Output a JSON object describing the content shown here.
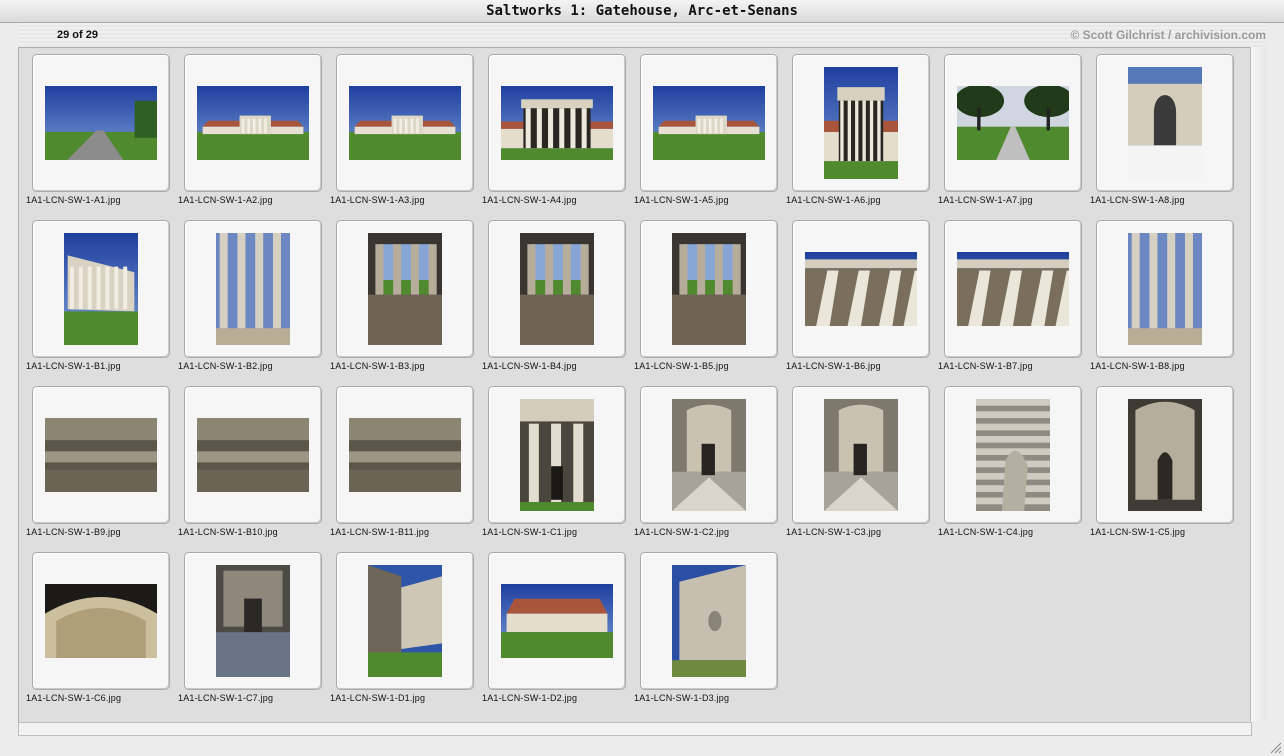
{
  "window": {
    "title": "Saltworks 1: Gatehouse, Arc-et-Senans"
  },
  "toolbar": {
    "count": "29 of 29",
    "credit": "© Scott Gilchrist / archivision.com"
  },
  "thumbnails": [
    {
      "caption": "1A1-LCN-SW-1-A1.jpg",
      "orientation": "landscape",
      "scene": "road"
    },
    {
      "caption": "1A1-LCN-SW-1-A2.jpg",
      "orientation": "landscape",
      "scene": "facade-far"
    },
    {
      "caption": "1A1-LCN-SW-1-A3.jpg",
      "orientation": "landscape",
      "scene": "facade-far"
    },
    {
      "caption": "1A1-LCN-SW-1-A4.jpg",
      "orientation": "landscape",
      "scene": "portico"
    },
    {
      "caption": "1A1-LCN-SW-1-A5.jpg",
      "orientation": "landscape",
      "scene": "facade-far"
    },
    {
      "caption": "1A1-LCN-SW-1-A6.jpg",
      "orientation": "portrait",
      "scene": "portico"
    },
    {
      "caption": "1A1-LCN-SW-1-A7.jpg",
      "orientation": "landscape",
      "scene": "trees"
    },
    {
      "caption": "1A1-LCN-SW-1-A8.jpg",
      "orientation": "portrait",
      "scene": "arch"
    },
    {
      "caption": "1A1-LCN-SW-1-B1.jpg",
      "orientation": "portrait",
      "scene": "portico-angle"
    },
    {
      "caption": "1A1-LCN-SW-1-B2.jpg",
      "orientation": "portrait",
      "scene": "columns-close"
    },
    {
      "caption": "1A1-LCN-SW-1-B3.jpg",
      "orientation": "portrait",
      "scene": "colonnade-dark"
    },
    {
      "caption": "1A1-LCN-SW-1-B4.jpg",
      "orientation": "portrait",
      "scene": "colonnade-dark"
    },
    {
      "caption": "1A1-LCN-SW-1-B5.jpg",
      "orientation": "portrait",
      "scene": "colonnade-dark"
    },
    {
      "caption": "1A1-LCN-SW-1-B6.jpg",
      "orientation": "landscape",
      "scene": "columns-up"
    },
    {
      "caption": "1A1-LCN-SW-1-B7.jpg",
      "orientation": "landscape",
      "scene": "columns-up"
    },
    {
      "caption": "1A1-LCN-SW-1-B8.jpg",
      "orientation": "portrait",
      "scene": "columns-close"
    },
    {
      "caption": "1A1-LCN-SW-1-B9.jpg",
      "orientation": "landscape",
      "scene": "ceiling"
    },
    {
      "caption": "1A1-LCN-SW-1-B10.jpg",
      "orientation": "landscape",
      "scene": "ceiling"
    },
    {
      "caption": "1A1-LCN-SW-1-B11.jpg",
      "orientation": "landscape",
      "scene": "ceiling"
    },
    {
      "caption": "1A1-LCN-SW-1-C1.jpg",
      "orientation": "portrait",
      "scene": "portico-front"
    },
    {
      "caption": "1A1-LCN-SW-1-C2.jpg",
      "orientation": "portrait",
      "scene": "grotto"
    },
    {
      "caption": "1A1-LCN-SW-1-C3.jpg",
      "orientation": "portrait",
      "scene": "grotto"
    },
    {
      "caption": "1A1-LCN-SW-1-C4.jpg",
      "orientation": "portrait",
      "scene": "rustic"
    },
    {
      "caption": "1A1-LCN-SW-1-C5.jpg",
      "orientation": "portrait",
      "scene": "grotto-dark"
    },
    {
      "caption": "1A1-LCN-SW-1-C6.jpg",
      "orientation": "landscape",
      "scene": "grotto-arch"
    },
    {
      "caption": "1A1-LCN-SW-1-C7.jpg",
      "orientation": "portrait",
      "scene": "grotto-door"
    },
    {
      "caption": "1A1-LCN-SW-1-D1.jpg",
      "orientation": "portrait",
      "scene": "wall-corner"
    },
    {
      "caption": "1A1-LCN-SW-1-D2.jpg",
      "orientation": "landscape",
      "scene": "pavilion"
    },
    {
      "caption": "1A1-LCN-SW-1-D3.jpg",
      "orientation": "portrait",
      "scene": "wall-urn"
    }
  ]
}
